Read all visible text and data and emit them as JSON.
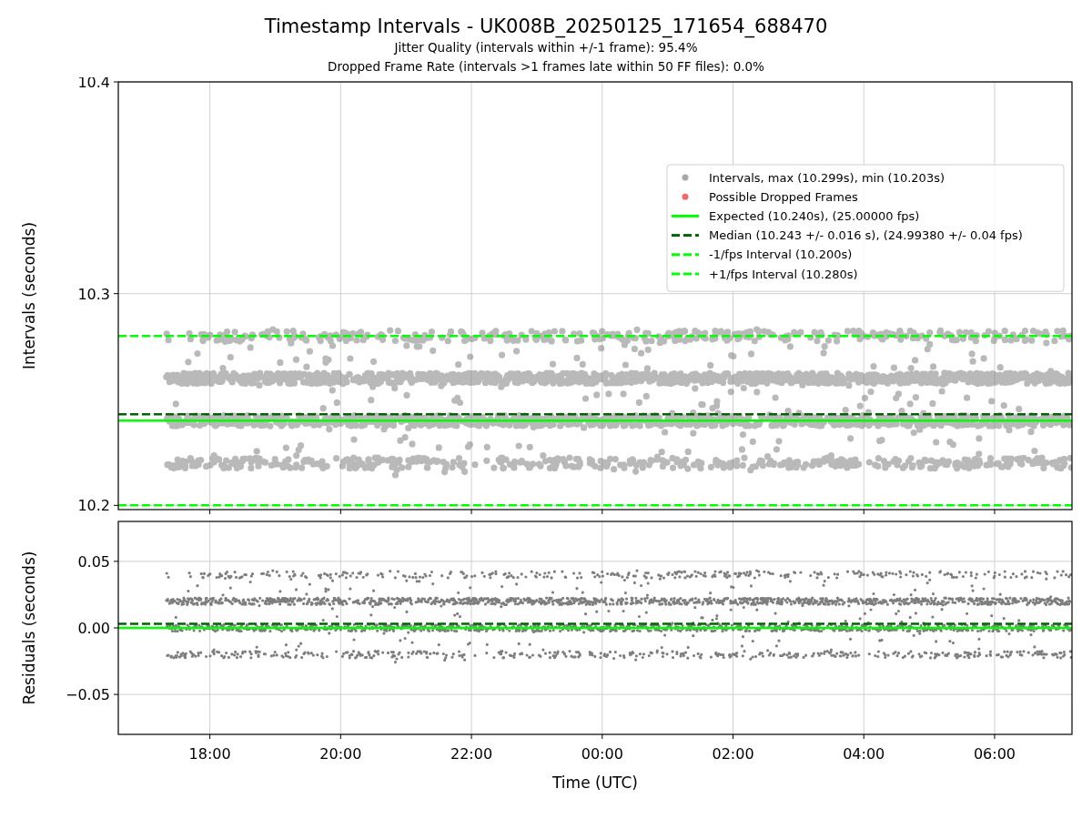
{
  "figure": {
    "title": "Timestamp Intervals - UK008B_20250125_171654_688470",
    "subtitles": [
      "Jitter Quality (intervals within +/-1 frame): 95.4%",
      "Dropped Frame Rate (intervals >1 frames late within 50 FF files): 0.0%"
    ]
  },
  "panels": [
    {
      "ylabel": "Intervals (seconds)",
      "legend": [
        {
          "label": "Intervals, max (10.299s), min (10.203s)",
          "kind": "scatter",
          "color": "#a8a8a8"
        },
        {
          "label": "Possible Dropped Frames",
          "kind": "scatter",
          "color": "#f06a6a"
        },
        {
          "label": "Expected (10.240s), (25.00000 fps)",
          "kind": "solid",
          "color": "#00ff00"
        },
        {
          "label": "Median (10.243 +/- 0.016 s), (24.99380 +/- 0.04 fps)",
          "kind": "dashed",
          "color": "#006400"
        },
        {
          "label": "-1/fps Interval (10.200s)",
          "kind": "dashed",
          "color": "#00ff00"
        },
        {
          "label": "+1/fps Interval (10.280s)",
          "kind": "dashed",
          "color": "#00ff00"
        }
      ],
      "chart_data": {
        "type": "line",
        "grid": true,
        "x": [
          "2025-01-25T16:36",
          "2025-01-26T07:11"
        ],
        "xlim": [
          "2025-01-25T16:36",
          "2025-01-26T07:11"
        ],
        "ylim": [
          10.198,
          10.4
        ],
        "yticks": [
          {
            "value": 10.2,
            "label": "10.2"
          },
          {
            "value": 10.3,
            "label": "10.3"
          },
          {
            "value": 10.4,
            "label": "10.4"
          }
        ],
        "series": [
          {
            "color": "#00ff00",
            "line_style": "solid",
            "values": [
              10.24,
              10.24
            ]
          },
          {
            "color": "#006400",
            "line_style": "dashed",
            "values": [
              10.243,
              10.243
            ]
          },
          {
            "color": "#00ff00",
            "line_style": "dashed",
            "values": [
              10.2,
              10.2
            ]
          },
          {
            "color": "#00ff00",
            "line_style": "dashed",
            "values": [
              10.28,
              10.28
            ]
          }
        ]
      }
    },
    {
      "ylabel": "Residuals (seconds)",
      "xlabel": "Time (UTC)",
      "chart_data": {
        "type": "line",
        "grid": true,
        "x": [
          "2025-01-25T16:36",
          "2025-01-26T07:11"
        ],
        "xlim": [
          "2025-01-25T16:36",
          "2025-01-26T07:11"
        ],
        "ylim": [
          -0.08,
          0.08
        ],
        "xticks": [
          {
            "value": "2025-01-25T18:00",
            "label": "18:00"
          },
          {
            "value": "2025-01-25T20:00",
            "label": "20:00"
          },
          {
            "value": "2025-01-25T22:00",
            "label": "22:00"
          },
          {
            "value": "2025-01-26T00:00",
            "label": "00:00"
          },
          {
            "value": "2025-01-26T02:00",
            "label": "02:00"
          },
          {
            "value": "2025-01-26T04:00",
            "label": "04:00"
          },
          {
            "value": "2025-01-26T06:00",
            "label": "06:00"
          }
        ],
        "yticks": [
          {
            "value": 0.05,
            "label": "0.05"
          },
          {
            "value": 0,
            "label": "0.00"
          },
          {
            "value": -0.05,
            "label": "−0.05"
          }
        ],
        "series": [
          {
            "color": "#00ff00",
            "line_style": "solid",
            "values": [
              0,
              0
            ]
          },
          {
            "color": "#006400",
            "line_style": "dashed",
            "values": [
              0.003,
              0.003
            ]
          }
        ]
      }
    }
  ]
}
